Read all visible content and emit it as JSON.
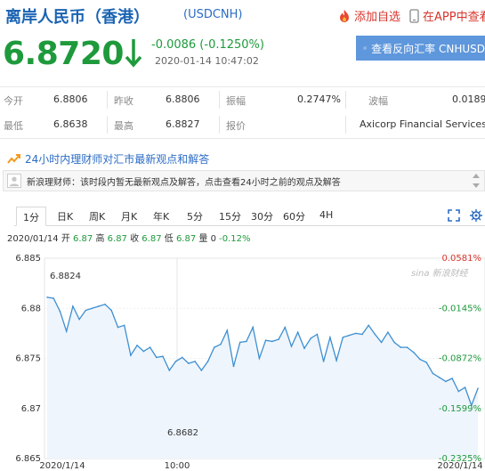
{
  "header": {
    "title": "离岸人民币（香港）",
    "code": "(USDCNH)",
    "add_watchlist": "添加自选",
    "view_in_app": "在APP中查看"
  },
  "quote": {
    "price": "6.8720",
    "change": "-0.0086 (-0.1250%)",
    "timestamp": "2020-01-14 10:47:02",
    "reverse_button": "查看反向汇率 CNHUSD",
    "direction": "down"
  },
  "stats": [
    [
      {
        "label": "今开",
        "value": "6.8806"
      },
      {
        "label": "昨收",
        "value": "6.8806"
      },
      {
        "label": "振幅",
        "value": "0.2747%"
      },
      {
        "label": "波幅",
        "value": "0.0189"
      }
    ],
    [
      {
        "label": "最低",
        "value": "6.8638"
      },
      {
        "label": "最高",
        "value": "6.8827"
      },
      {
        "label": "报价",
        "value": ""
      },
      {
        "label": "",
        "value": "Axicorp Financial Services"
      }
    ]
  ],
  "expert": {
    "link": "24小时内理财师对汇市最新观点和解答",
    "notice": "新浪理财师：该时段内暂无最新观点及解答，点击查看24小时之前的观点及解答"
  },
  "tabs": [
    "1分",
    "日K",
    "周K",
    "月K",
    "年K",
    "5分",
    "15分",
    "30分",
    "60分",
    "4H"
  ],
  "active_tab": "1分",
  "summary": {
    "date": "2020/01/14",
    "open_label": "开",
    "open": "6.87",
    "high_label": "高",
    "high": "6.87",
    "close_label": "收",
    "close": "6.87",
    "low_label": "低",
    "low": "6.87",
    "vol_label": "量",
    "vol": "0",
    "pct": "-0.12%"
  },
  "colors": {
    "up": "#d8342b",
    "down": "#1e9a3c",
    "brand": "#1a63b3",
    "line": "#3d8fd1"
  },
  "chart_data": {
    "type": "line",
    "watermark": "sina 新浪财经",
    "x_ticks": [
      "2020/1/14",
      "10:00",
      "2020/1/14"
    ],
    "ylim": [
      6.865,
      6.885
    ],
    "y_ticks": [
      "6.885",
      "6.88",
      "6.875",
      "6.87",
      "6.865"
    ],
    "right_ticks": [
      {
        "value": "0.0581%",
        "color": "#d8342b"
      },
      {
        "value": "-0.0145%",
        "color": "#1e9a3c"
      },
      {
        "value": "-0.0872%",
        "color": "#1e9a3c"
      },
      {
        "value": "-0.1599%",
        "color": "#1e9a3c"
      },
      {
        "value": "-0.2325%",
        "color": "#1e9a3c"
      }
    ],
    "annotations": {
      "max_label": "6.8824",
      "min_label": "6.8682"
    },
    "series": [
      {
        "values": [
          6.8811,
          6.881,
          6.8797,
          6.8777,
          6.8802,
          6.8789,
          6.8798,
          6.88,
          6.8802,
          6.8804,
          6.8798,
          6.8781,
          6.8783,
          6.8753,
          6.8763,
          6.8757,
          6.8761,
          6.8751,
          6.8752,
          6.8738,
          6.8747,
          6.8751,
          6.8745,
          6.8747,
          6.8738,
          6.8747,
          6.8761,
          6.8764,
          6.8778,
          6.8742,
          6.8766,
          6.8767,
          6.8781,
          6.875,
          6.8768,
          6.8767,
          6.8769,
          6.8781,
          6.8762,
          6.8776,
          6.876,
          6.877,
          6.8774,
          6.8747,
          6.8771,
          6.8748,
          6.8771,
          6.8773,
          6.8775,
          6.8774,
          6.8783,
          6.8774,
          6.8766,
          6.8776,
          6.8766,
          6.8761,
          6.8761,
          6.8756,
          6.8749,
          6.8746,
          6.8735,
          6.8731,
          6.8727,
          6.873,
          6.8717,
          6.8721,
          6.8703,
          6.872
        ]
      }
    ]
  }
}
